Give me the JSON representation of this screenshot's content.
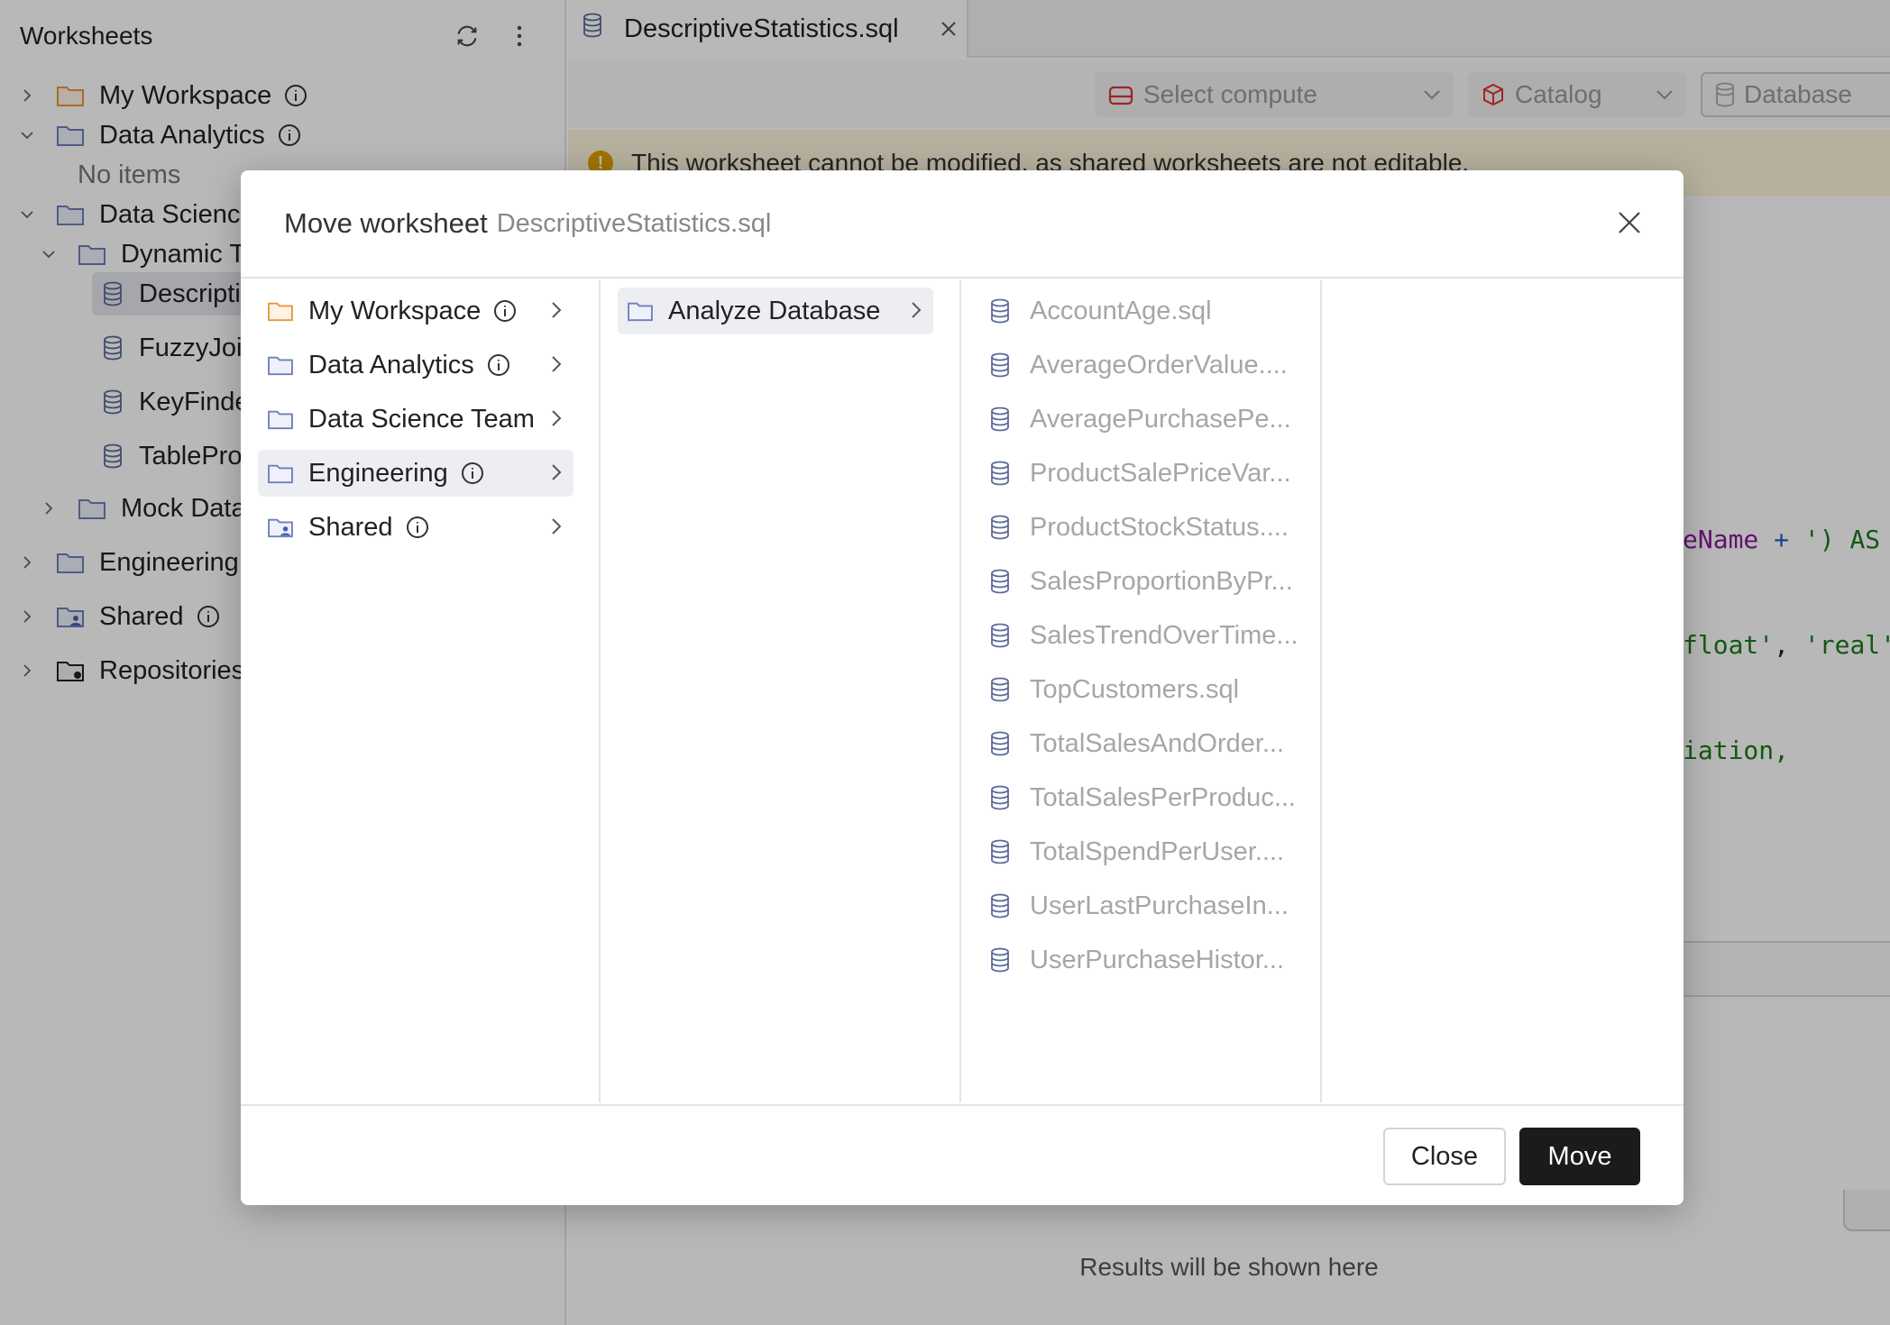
{
  "sidebar": {
    "title": "Worksheets",
    "tree": [
      {
        "label": "My Workspace",
        "info": true
      },
      {
        "label": "Data Analytics",
        "info": true
      },
      {
        "label": "No items"
      },
      {
        "label": "Data Science"
      },
      {
        "label": "Dynamic T"
      },
      {
        "label": "Descripti"
      },
      {
        "label": "FuzzyJoi"
      },
      {
        "label": "KeyFinde"
      },
      {
        "label": "TablePro"
      },
      {
        "label": "Mock Data"
      },
      {
        "label": "Engineering"
      },
      {
        "label": "Shared",
        "info": true
      },
      {
        "label": "Repositories"
      }
    ]
  },
  "tab": {
    "label": "DescriptiveStatistics.sql"
  },
  "toolbar": {
    "compute": "Select compute",
    "catalog": "Catalog",
    "database": "Database"
  },
  "banner": {
    "text": "This worksheet cannot be modified, as shared worksheets are not editable."
  },
  "code": {
    "line1": {
      "a": "eName ",
      "b": "+",
      "c": " ') AS"
    },
    "line2": {
      "a": "float'",
      "b": ", ",
      "c": "'real'"
    },
    "line3": "iation,"
  },
  "results": {
    "empty_text": "Results will be shown here"
  },
  "modal": {
    "title": "Move worksheet",
    "subtitle": "DescriptiveStatistics.sql",
    "column1": [
      {
        "label": "My Workspace",
        "info": true
      },
      {
        "label": "Data Analytics",
        "info": true
      },
      {
        "label": "Data Science Team",
        "info": false
      },
      {
        "label": "Engineering",
        "info": true,
        "selected": true
      },
      {
        "label": "Shared",
        "info": true
      }
    ],
    "column2": [
      {
        "label": "Analyze Database",
        "selected": true
      }
    ],
    "column3": [
      "AccountAge.sql",
      "AverageOrderValue....",
      "AveragePurchasePe...",
      "ProductSalePriceVar...",
      "ProductStockStatus....",
      "SalesProportionByPr...",
      "SalesTrendOverTime...",
      "TopCustomers.sql",
      "TotalSalesAndOrder...",
      "TotalSalesPerProduc...",
      "TotalSpendPerUser....",
      "UserLastPurchaseIn...",
      "UserPurchaseHistor..."
    ],
    "close_label": "Close",
    "move_label": "Move"
  },
  "colors": {
    "workspace_folder": "#e8963a",
    "folder": "#6f7fb8",
    "primary_button": "#1b1b1b",
    "banner_bg": "#fdf5dc"
  }
}
